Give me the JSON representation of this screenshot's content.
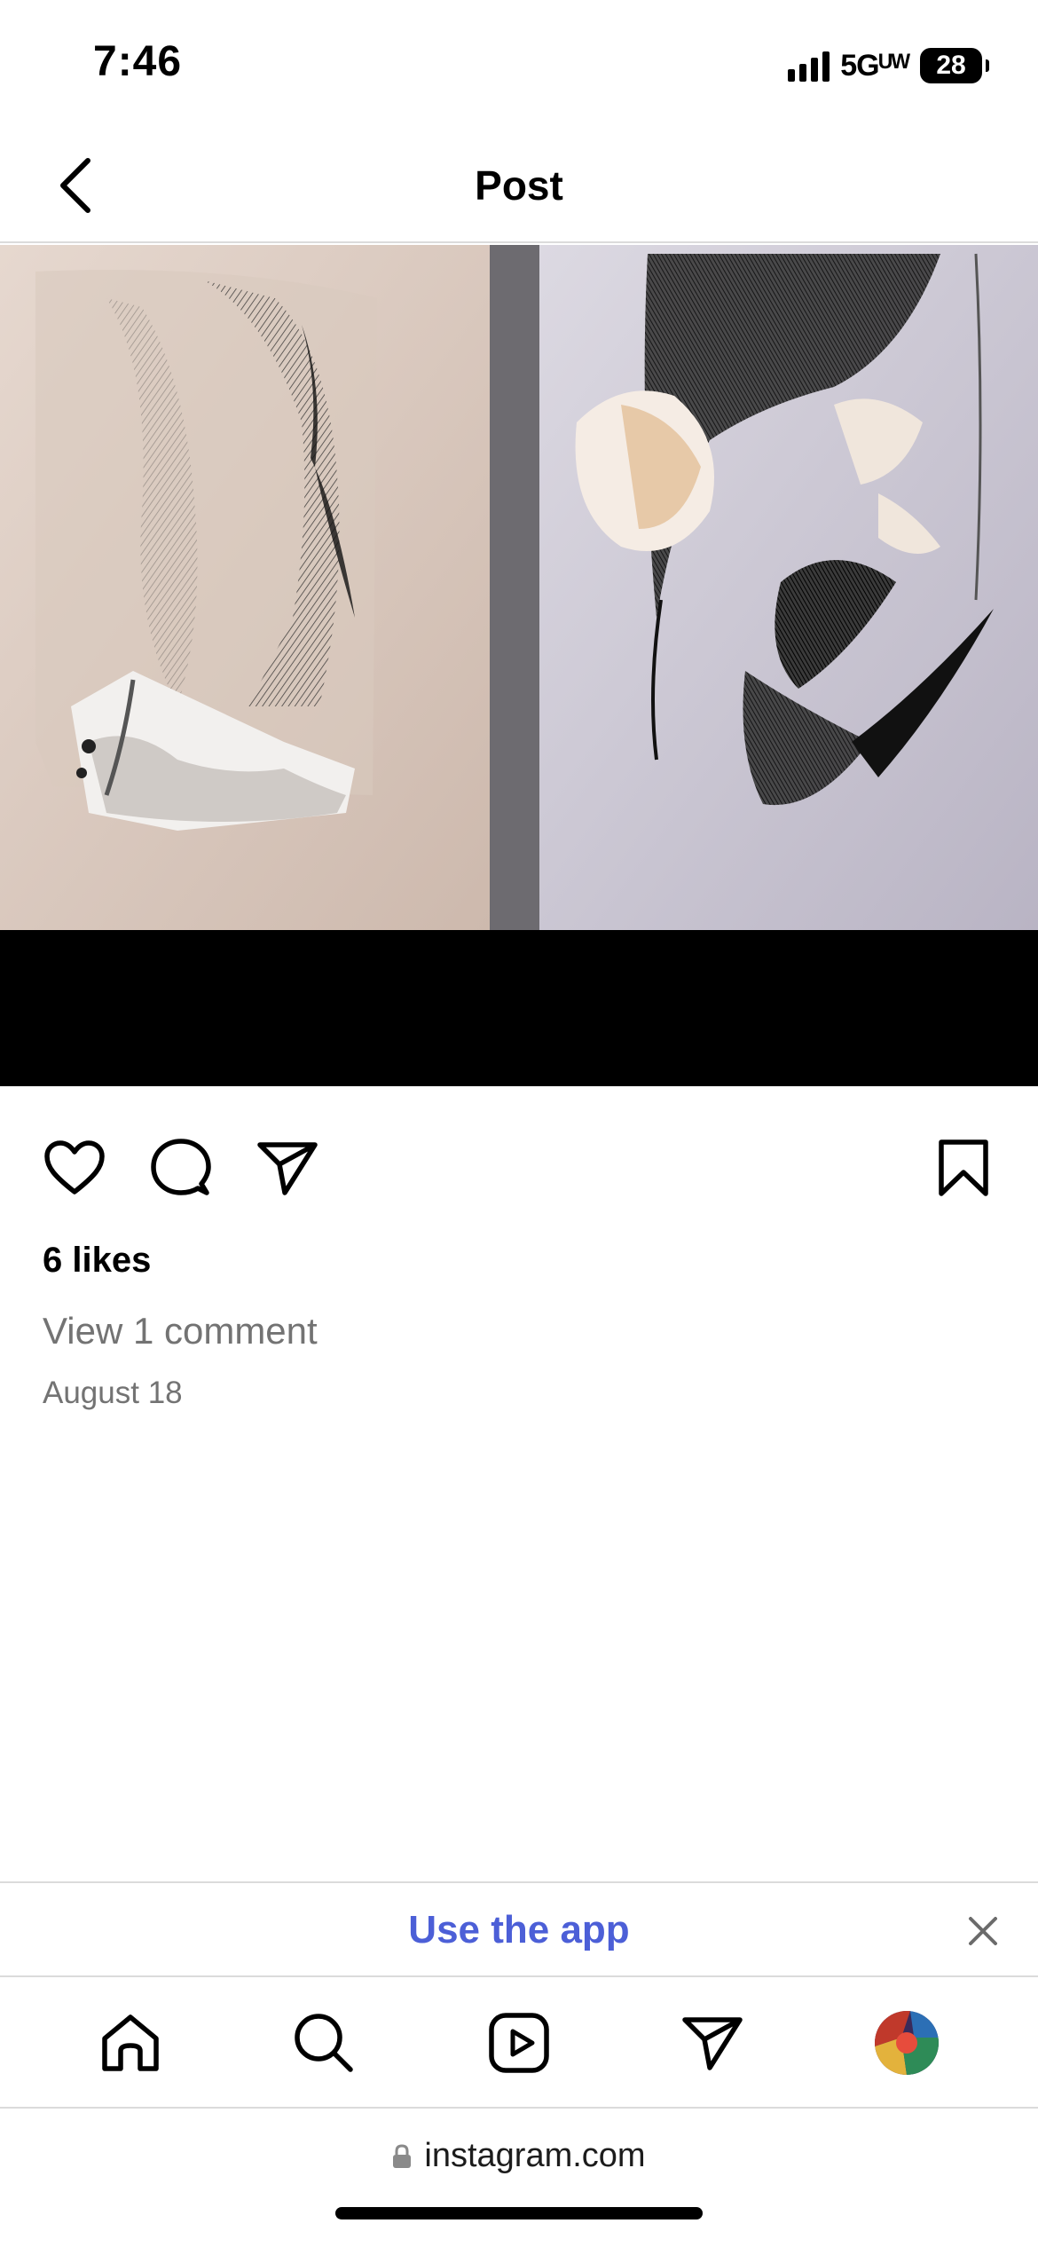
{
  "status_bar": {
    "time": "7:46",
    "network": "5Gᵁᵂ",
    "battery": "28"
  },
  "header": {
    "title": "Post",
    "back_icon": "chevron-left-icon"
  },
  "post": {
    "image_description_icon": "post-photo",
    "actions": {
      "like_icon": "heart-icon",
      "comment_icon": "comment-icon",
      "share_icon": "paper-plane-icon",
      "save_icon": "bookmark-icon"
    },
    "likes": "6 likes",
    "view_comments": "View 1 comment",
    "date": "August 18"
  },
  "app_banner": {
    "label": "Use the app",
    "close_icon": "close-icon",
    "accent": "#4c5fd7"
  },
  "bottom_nav": {
    "items": [
      {
        "icon": "home-icon"
      },
      {
        "icon": "search-icon"
      },
      {
        "icon": "reels-icon"
      },
      {
        "icon": "direct-icon"
      },
      {
        "icon": "profile-avatar"
      }
    ]
  },
  "browser": {
    "url": "instagram.com",
    "lock_icon": "lock-icon"
  }
}
